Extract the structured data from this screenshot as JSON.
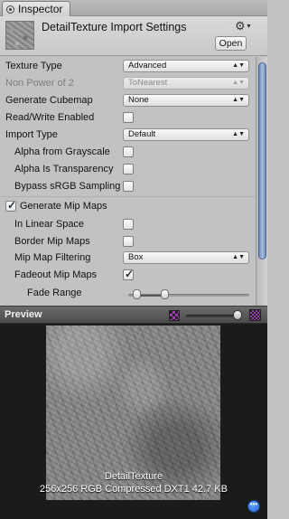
{
  "tab": {
    "label": "Inspector",
    "icon": "inspector-icon"
  },
  "header": {
    "title": "DetailTexture Import Settings",
    "open_label": "Open",
    "settings_icon": "gear-icon"
  },
  "fields": {
    "texture_type": {
      "label": "Texture Type",
      "value": "Advanced"
    },
    "non_power_of_2": {
      "label": "Non Power of 2",
      "value": "ToNearest"
    },
    "generate_cubemap": {
      "label": "Generate Cubemap",
      "value": "None"
    },
    "read_write": {
      "label": "Read/Write Enabled",
      "checked": false
    },
    "import_type": {
      "label": "Import Type",
      "value": "Default"
    },
    "alpha_from_grayscale": {
      "label": "Alpha from Grayscale",
      "checked": false
    },
    "alpha_is_transparency": {
      "label": "Alpha Is Transparency",
      "checked": false
    },
    "bypass_srgb": {
      "label": "Bypass sRGB Sampling",
      "checked": false
    },
    "generate_mip_maps": {
      "label": "Generate Mip Maps",
      "checked": true
    },
    "in_linear_space": {
      "label": "In Linear Space",
      "checked": false
    },
    "border_mip_maps": {
      "label": "Border Mip Maps",
      "checked": false
    },
    "mip_map_filtering": {
      "label": "Mip Map Filtering",
      "value": "Box"
    },
    "fadeout_mip_maps": {
      "label": "Fadeout Mip Maps",
      "checked": true
    },
    "fade_range": {
      "label": "Fade Range",
      "min_fraction": 0.07,
      "max_fraction": 0.3
    }
  },
  "preview": {
    "title": "Preview",
    "mip_level_fraction": 1.0,
    "texture_name": "DetailTexture",
    "texture_info": "256x256  RGB Compressed DXT1   42.7 KB"
  },
  "colors": {
    "panel_bg": "#c2c2c2",
    "preview_bg": "#1b1b1b",
    "scrollbar_thumb": "#a7bfdf",
    "mip_icon": "#9b3bb0"
  }
}
